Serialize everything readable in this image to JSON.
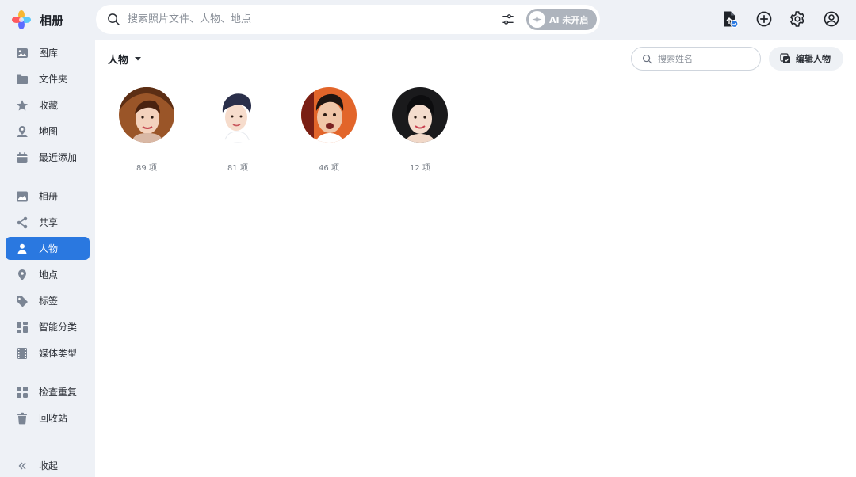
{
  "app": {
    "title": "相册"
  },
  "search": {
    "placeholder": "搜索照片文件、人物、地点",
    "value": ""
  },
  "ai_toggle": {
    "label": "AI 未开启",
    "enabled": false
  },
  "header_icons": [
    "upload-file-icon",
    "add-icon",
    "settings-icon",
    "account-icon"
  ],
  "sidebar": {
    "groups": [
      [
        {
          "label": "图库",
          "icon": "photo-library-icon"
        },
        {
          "label": "文件夹",
          "icon": "folder-icon"
        },
        {
          "label": "收藏",
          "icon": "star-icon"
        },
        {
          "label": "地图",
          "icon": "map-icon"
        },
        {
          "label": "最近添加",
          "icon": "calendar-icon"
        }
      ],
      [
        {
          "label": "相册",
          "icon": "album-icon"
        },
        {
          "label": "共享",
          "icon": "share-icon"
        },
        {
          "label": "人物",
          "icon": "person-icon",
          "active": true
        },
        {
          "label": "地点",
          "icon": "location-pin-icon"
        },
        {
          "label": "标签",
          "icon": "tag-icon"
        },
        {
          "label": "智能分类",
          "icon": "smart-category-icon"
        },
        {
          "label": "媒体类型",
          "icon": "film-icon"
        }
      ],
      [
        {
          "label": "检查重复",
          "icon": "duplicates-icon"
        },
        {
          "label": "回收站",
          "icon": "trash-icon"
        }
      ]
    ],
    "collapse_label": "收起"
  },
  "main": {
    "section_title": "人物",
    "name_search_placeholder": "搜索姓名",
    "edit_button_label": "编辑人物",
    "people": [
      {
        "count_label": "89 项"
      },
      {
        "count_label": "81 项"
      },
      {
        "count_label": "46 项"
      },
      {
        "count_label": "12 项"
      }
    ]
  },
  "colors": {
    "accent": "#2a78e0",
    "sidebar_bg": "#eef1f6",
    "icon_gray": "#7b8594"
  }
}
